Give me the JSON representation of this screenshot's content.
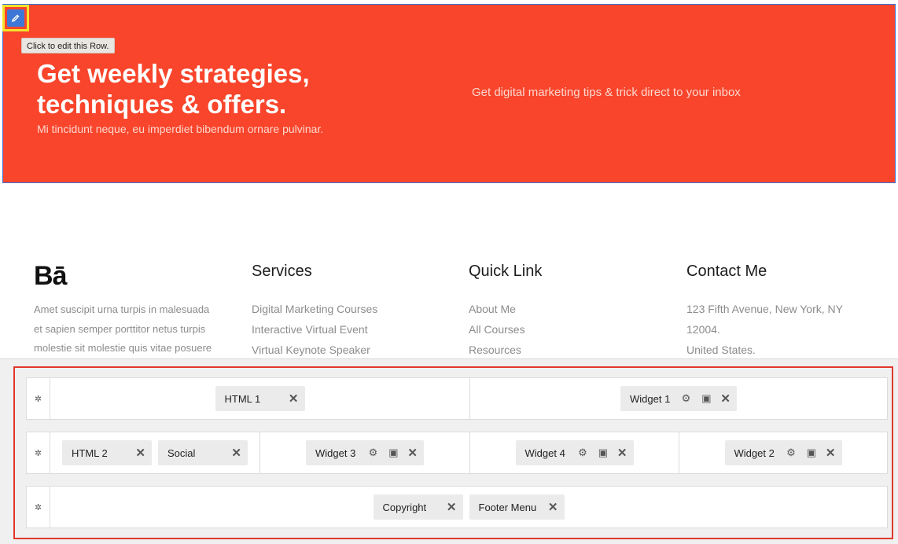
{
  "hero": {
    "tooltip": "Click to edit this Row.",
    "title": "Get weekly strategies, techniques & offers.",
    "subtitle": "Mi tincidunt neque, eu imperdiet bibendum ornare pulvinar.",
    "right_text": "Get digital marketing tips & trick direct to your inbox"
  },
  "footer": {
    "logo": "Bā",
    "about": "Amet suscipit urna turpis in malesuada et sapien semper porttitor netus turpis molestie sit molestie quis vitae posuere",
    "services": {
      "title": "Services",
      "items": [
        "Digital Marketing Courses",
        "Interactive Virtual Event",
        "Virtual Keynote Speaker"
      ]
    },
    "quick_link": {
      "title": "Quick Link",
      "items": [
        "About Me",
        "All Courses",
        "Resources"
      ]
    },
    "contact": {
      "title": "Contact Me",
      "lines": [
        "123 Fifth Avenue, New York, NY",
        "12004.",
        "United States."
      ]
    }
  },
  "builder": {
    "row1": {
      "html1": "HTML 1",
      "widget1": "Widget 1"
    },
    "row2": {
      "html2": "HTML 2",
      "social": "Social",
      "widget3": "Widget 3",
      "widget4": "Widget 4",
      "widget2": "Widget 2"
    },
    "row3": {
      "copyright": "Copyright",
      "footer_menu": "Footer Menu"
    }
  },
  "colors": {
    "accent": "#f8452b",
    "frame": "#e0392b",
    "edit": "#3e78d6"
  }
}
